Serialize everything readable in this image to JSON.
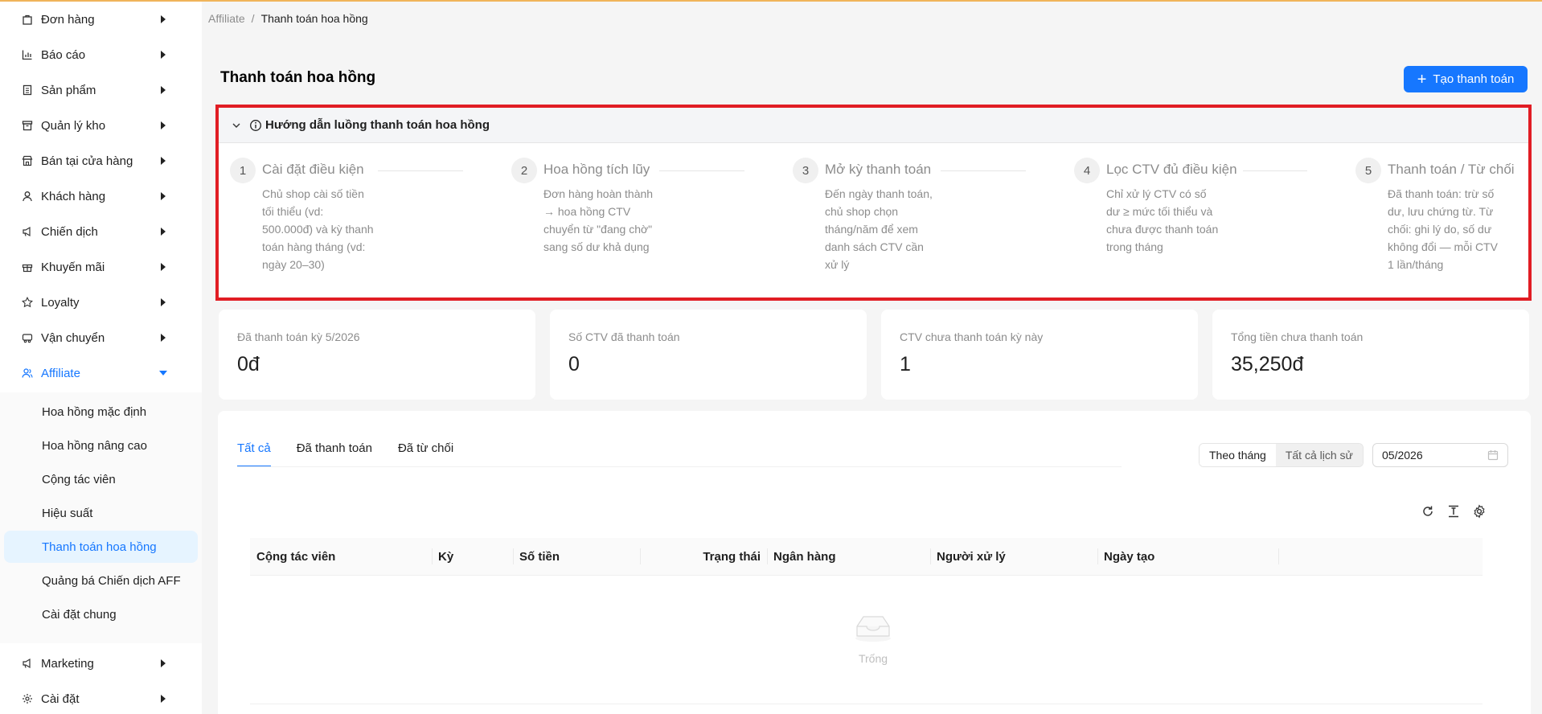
{
  "sidebar": {
    "items": [
      {
        "label": "Đơn hàng",
        "icon": "bag-icon"
      },
      {
        "label": "Báo cáo",
        "icon": "bar-chart-icon"
      },
      {
        "label": "Sản phẩm",
        "icon": "document-icon"
      },
      {
        "label": "Quản lý kho",
        "icon": "archive-icon"
      },
      {
        "label": "Bán tại cửa hàng",
        "icon": "store-icon"
      },
      {
        "label": "Khách hàng",
        "icon": "user-icon"
      },
      {
        "label": "Chiến dịch",
        "icon": "megaphone-icon"
      },
      {
        "label": "Khuyến mãi",
        "icon": "gift-icon"
      },
      {
        "label": "Loyalty",
        "icon": "star-icon"
      },
      {
        "label": "Vận chuyển",
        "icon": "truck-icon"
      },
      {
        "label": "Affiliate",
        "icon": "users-icon"
      }
    ],
    "affiliate_sub": [
      "Hoa hồng mặc định",
      "Hoa hồng nâng cao",
      "Cộng tác viên",
      "Hiệu suất",
      "Thanh toán hoa hồng",
      "Quảng bá Chiến dịch AFF",
      "Cài đặt chung"
    ],
    "bottom_items": [
      {
        "label": "Marketing",
        "icon": "megaphone-icon"
      },
      {
        "label": "Cài đặt",
        "icon": "gear-icon"
      }
    ]
  },
  "breadcrumb": {
    "root": "Affiliate",
    "sep": "/",
    "current": "Thanh toán hoa hồng"
  },
  "page": {
    "title": "Thanh toán hoa hồng",
    "create_button": "Tạo thanh toán"
  },
  "guide": {
    "title": "Hướng dẫn luồng thanh toán hoa hồng",
    "steps": [
      {
        "num": "1",
        "title": "Cài đặt điều kiện",
        "desc": "Chủ shop cài số tiền tối thiểu (vd: 500.000đ) và kỳ thanh toán hàng tháng (vd: ngày 20–30)"
      },
      {
        "num": "2",
        "title": "Hoa hồng tích lũy",
        "desc": "Đơn hàng hoàn thành → hoa hồng CTV chuyển từ \"đang chờ\" sang số dư khả dụng"
      },
      {
        "num": "3",
        "title": "Mở kỳ thanh toán",
        "desc": "Đến ngày thanh toán, chủ shop chọn tháng/năm để xem danh sách CTV cần xử lý"
      },
      {
        "num": "4",
        "title": "Lọc CTV đủ điều kiện",
        "desc": "Chỉ xử lý CTV có số dư ≥ mức tối thiểu và chưa được thanh toán trong tháng"
      },
      {
        "num": "5",
        "title": "Thanh toán / Từ chối",
        "desc": "Đã thanh toán: trừ số dư, lưu chứng từ. Từ chối: ghi lý do, số dư không đổi — mỗi CTV 1 lần/tháng"
      }
    ]
  },
  "stats": [
    {
      "label": "Đã thanh toán kỳ 5/2026",
      "value": "0đ"
    },
    {
      "label": "Số CTV đã thanh toán",
      "value": "0"
    },
    {
      "label": "CTV chưa thanh toán kỳ này",
      "value": "1"
    },
    {
      "label": "Tổng tiền chưa thanh toán",
      "value": "35,250đ"
    }
  ],
  "tabs": [
    "Tất cả",
    "Đã thanh toán",
    "Đã từ chối"
  ],
  "filter": {
    "by_month": "Theo tháng",
    "all_history": "Tất cả lịch sử",
    "month_value": "05/2026"
  },
  "table": {
    "columns": [
      "Cộng tác viên",
      "Kỳ",
      "Số tiền",
      "Trạng thái",
      "Ngân hàng",
      "Người xử lý",
      "Ngày tạo"
    ],
    "empty_text": "Trống"
  },
  "colors": {
    "primary": "#1677ff",
    "highlight_border": "#e11d24"
  }
}
